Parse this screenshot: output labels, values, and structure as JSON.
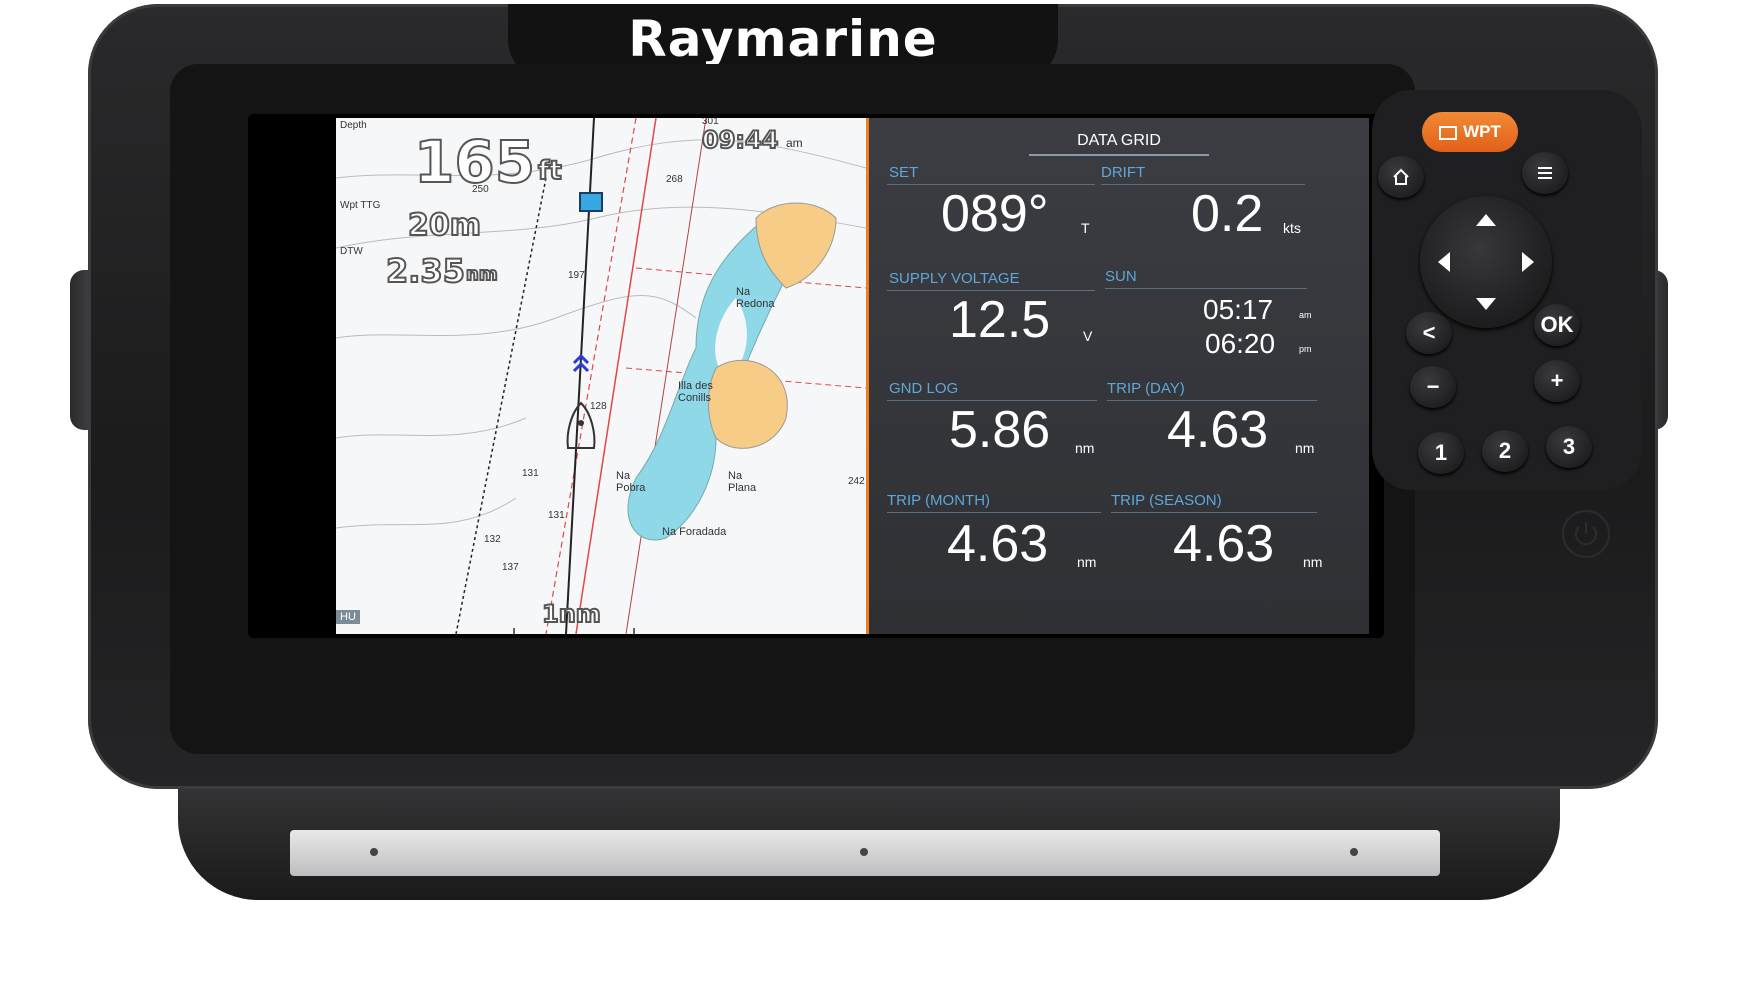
{
  "device": {
    "brand": "Raymarine"
  },
  "chart": {
    "depth_label": "Depth",
    "depth_value": "165",
    "depth_unit": "ft",
    "wpt_ttg_label": "Wpt TTG",
    "wpt_ttg_value": "20m",
    "dtw_label": "DTW",
    "dtw_value": "2.35",
    "dtw_unit": "nm",
    "time": "09:44",
    "time_ampm": "am",
    "scale": "1nm",
    "orientation": "HU",
    "soundings": [
      "301",
      "268",
      "250",
      "197",
      "128",
      "131",
      "131",
      "132",
      "137",
      "242"
    ],
    "places": [
      "Na Redona",
      "Illa des Conills",
      "Na Pobra",
      "Na Plana",
      "Na Foradada"
    ],
    "colors": {
      "water": "#f6f7f8",
      "shallow": "#8fd8e8",
      "land": "#f7cc86",
      "route": "#222222",
      "limit": "#e04848",
      "cursor": "#f07c22"
    }
  },
  "data_grid": {
    "title": "DATA GRID",
    "cells": [
      {
        "label": "SET",
        "value": "089°",
        "unit": "T"
      },
      {
        "label": "DRIFT",
        "value": "0.2",
        "unit": "kts"
      },
      {
        "label": "SUPPLY VOLTAGE",
        "value": "12.5",
        "unit": "V"
      },
      {
        "label": "SUN",
        "rise": "05:17",
        "rise_unit": "am",
        "set": "06:20",
        "set_unit": "pm"
      },
      {
        "label": "GND LOG",
        "value": "5.86",
        "unit": "nm"
      },
      {
        "label": "TRIP (DAY)",
        "value": "4.63",
        "unit": "nm"
      },
      {
        "label": "TRIP (MONTH)",
        "value": "4.63",
        "unit": "nm"
      },
      {
        "label": "TRIP (SEASON)",
        "value": "4.63",
        "unit": "nm"
      }
    ],
    "colors": {
      "label": "#5fa7d9",
      "value": "#ffffff",
      "background": "#34363b"
    }
  },
  "keypad": {
    "wpt_label": "WPT",
    "ok_label": "OK",
    "back_label": "<",
    "minus_label": "−",
    "plus_label": "+",
    "num1": "1",
    "num2": "2",
    "num3": "3",
    "icons": [
      "home-icon",
      "menu-icon",
      "arrow-up-icon",
      "arrow-down-icon",
      "arrow-left-icon",
      "arrow-right-icon",
      "power-icon",
      "flag-icon"
    ],
    "colors": {
      "wpt": "#f07c22"
    }
  }
}
